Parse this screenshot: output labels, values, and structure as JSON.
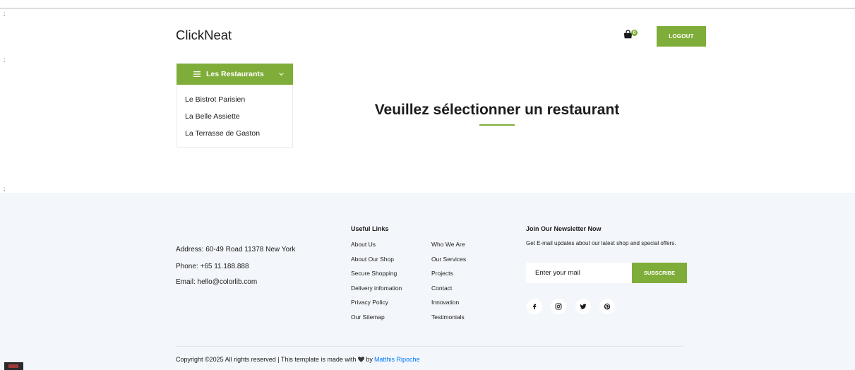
{
  "stray_marks": [
    ";",
    ";",
    ";"
  ],
  "header": {
    "logo": "ClickNeat",
    "cart": {
      "icon": "shopping-bag-icon",
      "count": "0"
    },
    "logout_label": "LOGOUT"
  },
  "sidebar": {
    "menu_icon": "hamburger-icon",
    "title": "Les Restaurants",
    "toggle_icon": "chevron-down-icon",
    "items": [
      "Le Bistrot Parisien",
      "La Belle Assiette",
      "La Terrasse de Gaston"
    ]
  },
  "main": {
    "heading": "Veuillez sélectionner un restaurant"
  },
  "footer": {
    "contact": {
      "address": "Address: 60-49 Road 11378 New York",
      "phone": "Phone: +65 11.188.888",
      "email": "Email: hello@colorlib.com"
    },
    "useful_links": {
      "title": "Useful Links",
      "column_1": [
        "About Us",
        "About Our Shop",
        "Secure Shopping",
        "Delivery infomation",
        "Privacy Policy",
        "Our Sitemap"
      ],
      "column_2": [
        "Who We Are",
        "Our Services",
        "Projects",
        "Contact",
        "Innovation",
        "Testimonials"
      ]
    },
    "newsletter": {
      "title": "Join Our Newsletter Now",
      "description": "Get E-mail updates about our latest shop and special offers.",
      "placeholder": "Enter your mail",
      "subscribe_label": "SUBSCRIBE",
      "social_icons": [
        "facebook-icon",
        "instagram-icon",
        "twitter-icon",
        "pinterest-icon"
      ]
    },
    "copyright": {
      "text": "Copyright ©2025 All rights reserved | This template is made with",
      "heart_icon": "heart-icon",
      "by": "by",
      "author": "Matthis Ripoche"
    }
  },
  "colors": {
    "accent": "#7fad39",
    "footer_bg": "#f3f6fa",
    "link": "#007bff",
    "text": "#1c1c1c"
  }
}
